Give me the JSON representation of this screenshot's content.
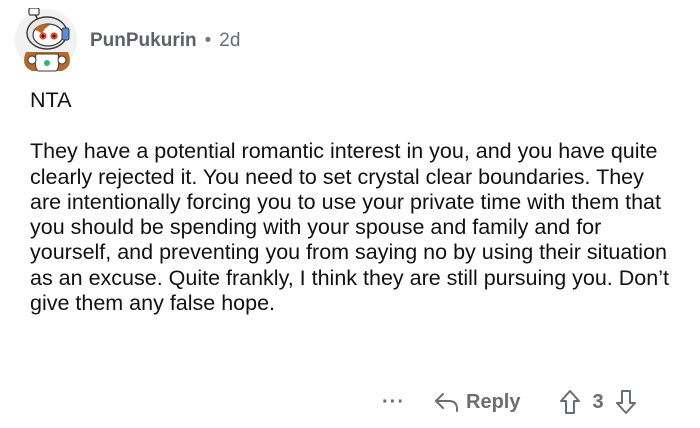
{
  "comment": {
    "author": "PunPukurin",
    "separator": "•",
    "age": "2d",
    "paragraphs": [
      "NTA",
      "They have a potential romantic interest in you, and you have quite clearly rejected it. You need to set crystal clear boundaries. They are intentionally forcing you to use your private time with them that you should be spending with your spouse and family and for yourself, and preventing you from saying no by using their situation as an excuse. Quite frankly, I think they are still pursuing you. Don’t give them any false hope."
    ],
    "actions": {
      "more": "···",
      "reply": "Reply",
      "score": "3"
    }
  },
  "icons": {
    "avatar": "snoo-avatar-icon",
    "reply": "reply-arrow-icon",
    "upvote": "upvote-arrow-icon",
    "downvote": "downvote-arrow-icon"
  },
  "colors": {
    "meta_text": "#6b6e71",
    "body_text": "#111111",
    "background": "#ffffff"
  }
}
